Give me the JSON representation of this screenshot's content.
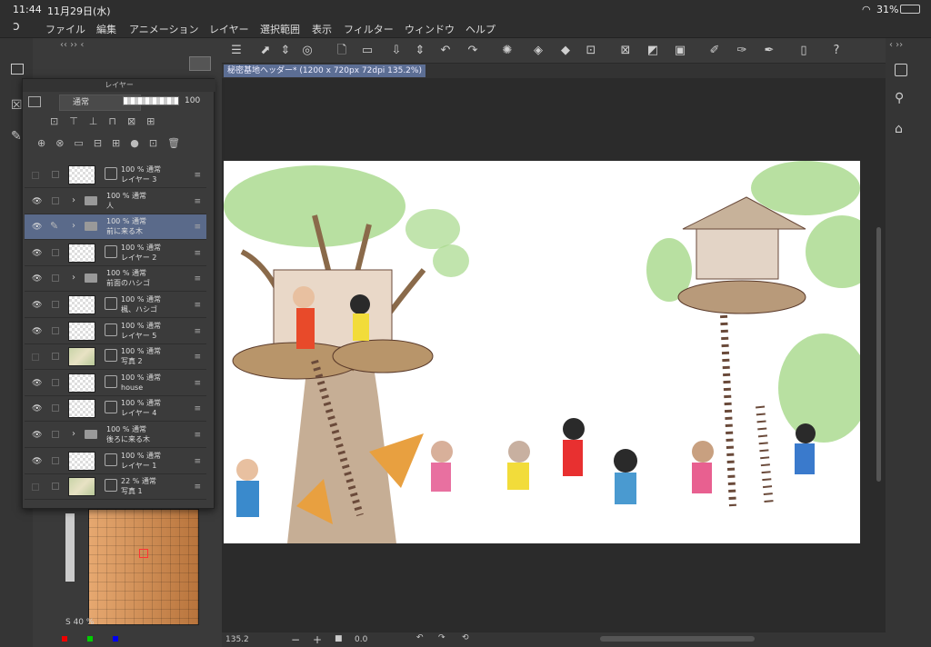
{
  "status": {
    "time": "11:44",
    "date": "11月29日(水)",
    "wifi": "wifi-icon",
    "battery": "31%"
  },
  "menu": [
    "ファイル",
    "編集",
    "アニメーション",
    "レイヤー",
    "選択範囲",
    "表示",
    "フィルター",
    "ウィンドウ",
    "ヘルプ"
  ],
  "document": {
    "tab_title": "秘密基地ヘッダー* (1200 x 720px 72dpi 135.2%)"
  },
  "layer_panel": {
    "title": "レイヤー",
    "blend_mode": "通常",
    "opacity": "100",
    "layers": [
      {
        "opacity": "100 %",
        "blend": "通常",
        "name": "レイヤー 3",
        "type": "layer",
        "visible": false
      },
      {
        "opacity": "100 %",
        "blend": "通常",
        "name": "人",
        "type": "folder",
        "visible": true
      },
      {
        "opacity": "100 %",
        "blend": "通常",
        "name": "前に来る木",
        "type": "folder",
        "visible": true,
        "selected": true
      },
      {
        "opacity": "100 %",
        "blend": "通常",
        "name": "レイヤー 2",
        "type": "layer",
        "visible": true
      },
      {
        "opacity": "100 %",
        "blend": "通常",
        "name": "前面のハシゴ",
        "type": "folder",
        "visible": true
      },
      {
        "opacity": "100 %",
        "blend": "通常",
        "name": "楓、ハシゴ",
        "type": "layer",
        "visible": true
      },
      {
        "opacity": "100 %",
        "blend": "通常",
        "name": "レイヤー 5",
        "type": "layer",
        "visible": true
      },
      {
        "opacity": "100 %",
        "blend": "通常",
        "name": "写真 2",
        "type": "photo",
        "visible": false
      },
      {
        "opacity": "100 %",
        "blend": "通常",
        "name": "house",
        "type": "layer",
        "visible": true
      },
      {
        "opacity": "100 %",
        "blend": "通常",
        "name": "レイヤー 4",
        "type": "layer",
        "visible": true
      },
      {
        "opacity": "100 %",
        "blend": "通常",
        "name": "後ろに来る木",
        "type": "folder",
        "visible": true
      },
      {
        "opacity": "100 %",
        "blend": "通常",
        "name": "レイヤー 1",
        "type": "layer",
        "visible": true
      },
      {
        "opacity": "22 %",
        "blend": "通常",
        "name": "写真 1",
        "type": "photo",
        "visible": false
      }
    ]
  },
  "brush_size_label": "S 40 %",
  "bottom": {
    "zoom": "135.2",
    "angle": "0.0"
  },
  "colors": {
    "accent": "#5a6a8a",
    "swatch_a": "#e6a870",
    "swatch_b": "#b8743c"
  }
}
